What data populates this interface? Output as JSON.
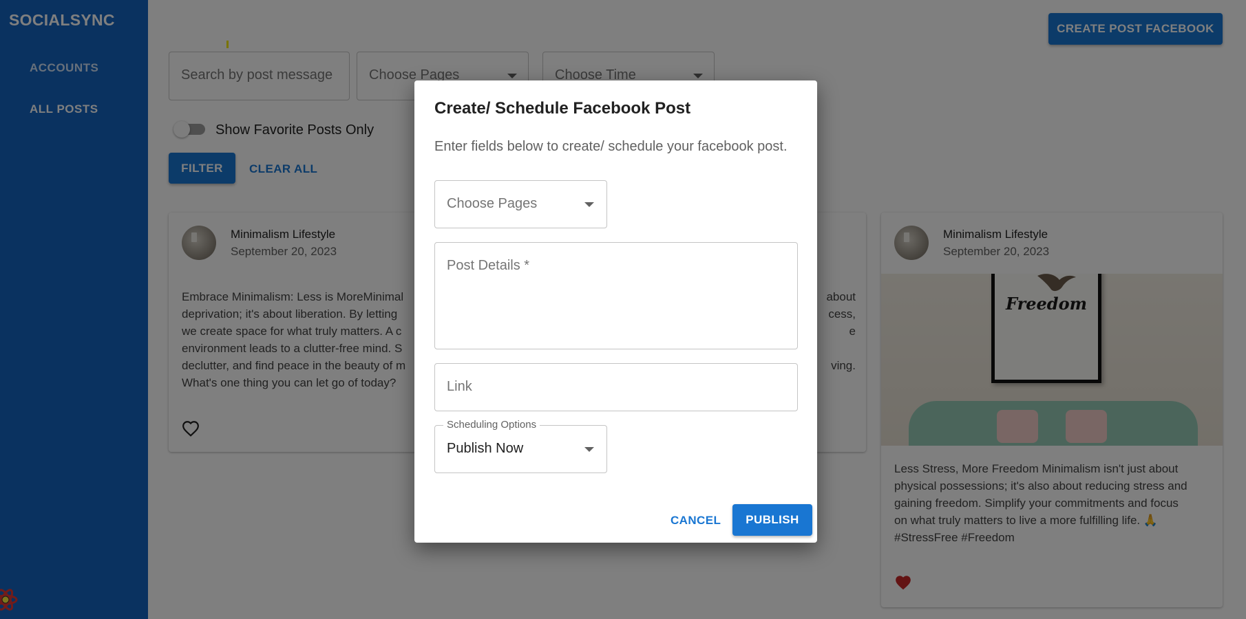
{
  "app": {
    "brand": "SOCIALSYNC"
  },
  "sidebar": {
    "items": [
      {
        "label": "ACCOUNTS",
        "active": false
      },
      {
        "label": "ALL POSTS",
        "active": true
      }
    ]
  },
  "header": {
    "create_button": "CREATE POST FACEBOOK"
  },
  "filters": {
    "search_placeholder": "Search by post message",
    "pages_placeholder": "Choose Pages",
    "time_placeholder": "Choose Time",
    "favorite_toggle_label": "Show Favorite Posts Only",
    "favorite_toggle_on": false,
    "filter_button": "FILTER",
    "clear_button": "CLEAR ALL"
  },
  "posts": [
    {
      "author": "Minimalism Lifestyle",
      "date": "September 20, 2023",
      "lines": [
        "Embrace Minimalism: Less is MoreMinimal",
        "deprivation; it's about liberation. By letting",
        "we create space for what truly matters. A c",
        "environment leads to a clutter-free mind. S",
        "declutter, and find peace in the beauty of m",
        "What's one thing you can let go of today?"
      ],
      "right_fragments": [
        "about",
        "cess,",
        "e",
        "",
        "ving."
      ],
      "favorite": false
    },
    {
      "author": "Minimalism Lifestyle",
      "date": "September 20, 2023",
      "image_text": "Freedom",
      "lines": [
        "Less Stress, More Freedom Minimalism isn't just about",
        "physical possessions; it's also about reducing stress and",
        "gaining freedom. Simplify your commitments and focus",
        "on what truly matters to live a more fulfilling life. 🙏",
        "#StressFree #Freedom"
      ],
      "favorite": true
    }
  ],
  "dialog": {
    "title": "Create/ Schedule Facebook Post",
    "description": "Enter fields below to create/ schedule your facebook post.",
    "pages_placeholder": "Choose Pages",
    "details_placeholder": "Post Details *",
    "link_placeholder": "Link",
    "scheduling_label": "Scheduling Options",
    "scheduling_value": "Publish Now",
    "cancel_button": "CANCEL",
    "publish_button": "PUBLISH"
  },
  "colors": {
    "primary": "#1976d2",
    "sidebar": "#1565c0",
    "favorite_red": "#c62828"
  }
}
